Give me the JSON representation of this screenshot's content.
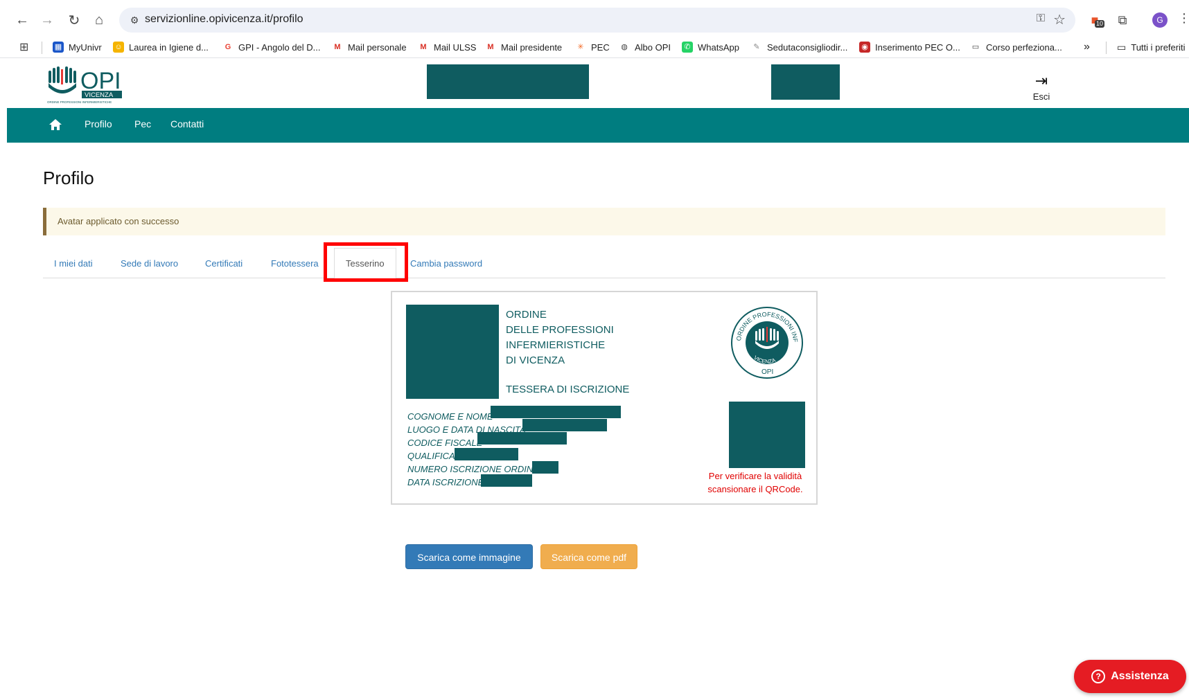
{
  "browser": {
    "url": "servizionline.opivicenza.it/profilo",
    "extension_badge": "10",
    "profile_initial": "G",
    "overflow_label": "»",
    "all_bookmarks": "Tutti i preferiti",
    "bookmarks": [
      {
        "label": "MyUnivr",
        "icon": "univr-icon",
        "color": "#1a56c9"
      },
      {
        "label": "Laurea in Igiene d...",
        "icon": "emoji-icon",
        "color": "#f5b400"
      },
      {
        "label": "GPI - Angolo del D...",
        "icon": "google-icon",
        "color": "#ea4335"
      },
      {
        "label": "Mail personale",
        "icon": "gmail-icon",
        "color": "#d93025"
      },
      {
        "label": "Mail ULSS",
        "icon": "gmail-icon",
        "color": "#d93025"
      },
      {
        "label": "Mail presidente",
        "icon": "gmail-icon",
        "color": "#d93025"
      },
      {
        "label": "PEC",
        "icon": "pec-icon",
        "color": "#f26722"
      },
      {
        "label": "Albo OPI",
        "icon": "globe-icon",
        "color": "#444444"
      },
      {
        "label": "WhatsApp",
        "icon": "whatsapp-icon",
        "color": "#25d366"
      },
      {
        "label": "Sedutaconsigliodir...",
        "icon": "pen-icon",
        "color": "#888888"
      },
      {
        "label": "Inserimento PEC O...",
        "icon": "pec-o-icon",
        "color": "#c62828"
      },
      {
        "label": "Corso perfeziona...",
        "icon": "folder-icon",
        "color": "#444444"
      }
    ]
  },
  "header": {
    "logo_text": "OPI",
    "logo_sub": "VICENZA",
    "logo_caption": "ORDINE PROFESSIONI INFERMIERISTICHE",
    "logout_label": "Esci"
  },
  "nav": {
    "items": [
      "Profilo",
      "Pec",
      "Contatti"
    ]
  },
  "page": {
    "title": "Profilo",
    "alert": "Avatar applicato con successo",
    "tabs": [
      "I miei dati",
      "Sede di lavoro",
      "Certificati",
      "Fototessera",
      "Tesserino",
      "Cambia password"
    ],
    "active_tab": "Tesserino"
  },
  "card": {
    "org_lines": [
      "ORDINE",
      "DELLE PROFESSIONI",
      "INFERMIERISTICHE",
      "DI VICENZA"
    ],
    "subtitle": "TESSERA DI ISCRIZIONE",
    "seal_text": "ORDINE PROFESSIONI INFERMIERISTICHE",
    "seal_city": "VICENZA",
    "seal_opi": "OPI",
    "fields": [
      "COGNOME E NOME",
      "LUOGO E DATA DI NASCITA",
      "CODICE FISCALE",
      "QUALIFICA",
      "NUMERO ISCRIZIONE ORDINE",
      "DATA ISCRIZIONE"
    ],
    "verify_line1": "Per verificare la validità",
    "verify_line2": "scansionare il QRCode."
  },
  "actions": {
    "download_image": "Scarica come immagine",
    "download_pdf": "Scarica come pdf"
  },
  "support": {
    "label": "Assistenza"
  },
  "colors": {
    "brand_teal": "#007d80",
    "redaction": "#0f5c60",
    "highlight": "#ff0000",
    "assist_red": "#e51c23"
  }
}
